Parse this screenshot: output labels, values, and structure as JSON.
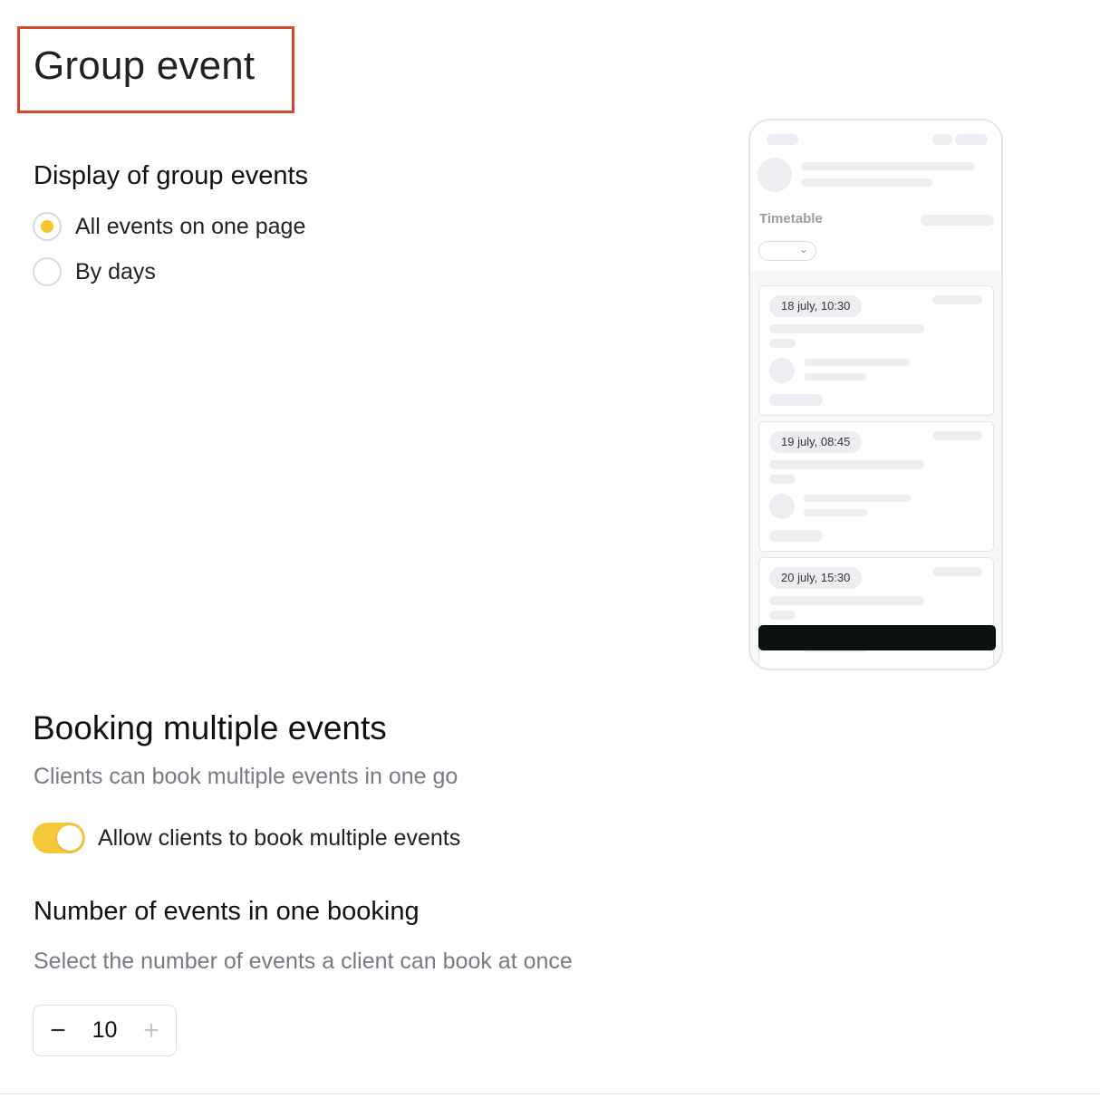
{
  "page": {
    "title": "Group event"
  },
  "display_section": {
    "heading": "Display of group events",
    "options": [
      {
        "label": "All events on one page",
        "selected": true
      },
      {
        "label": "By days",
        "selected": false
      }
    ]
  },
  "preview": {
    "timetable_label": "Timetable",
    "events": [
      {
        "date": "18 july, 10:30"
      },
      {
        "date": "19 july, 08:45"
      },
      {
        "date": "20 july, 15:30"
      }
    ]
  },
  "booking_section": {
    "heading": "Booking multiple events",
    "description": "Clients can book multiple events in one go",
    "toggle": {
      "label": "Allow clients to book multiple events",
      "on": true
    }
  },
  "count_section": {
    "heading": "Number of events in one booking",
    "description": "Select the number of events a client can book at once",
    "stepper": {
      "value": "10",
      "minus": "−",
      "plus": "+"
    }
  },
  "colors": {
    "accent": "#f5c52e",
    "highlight_border": "#d9472e",
    "muted_text": "#777b82"
  }
}
